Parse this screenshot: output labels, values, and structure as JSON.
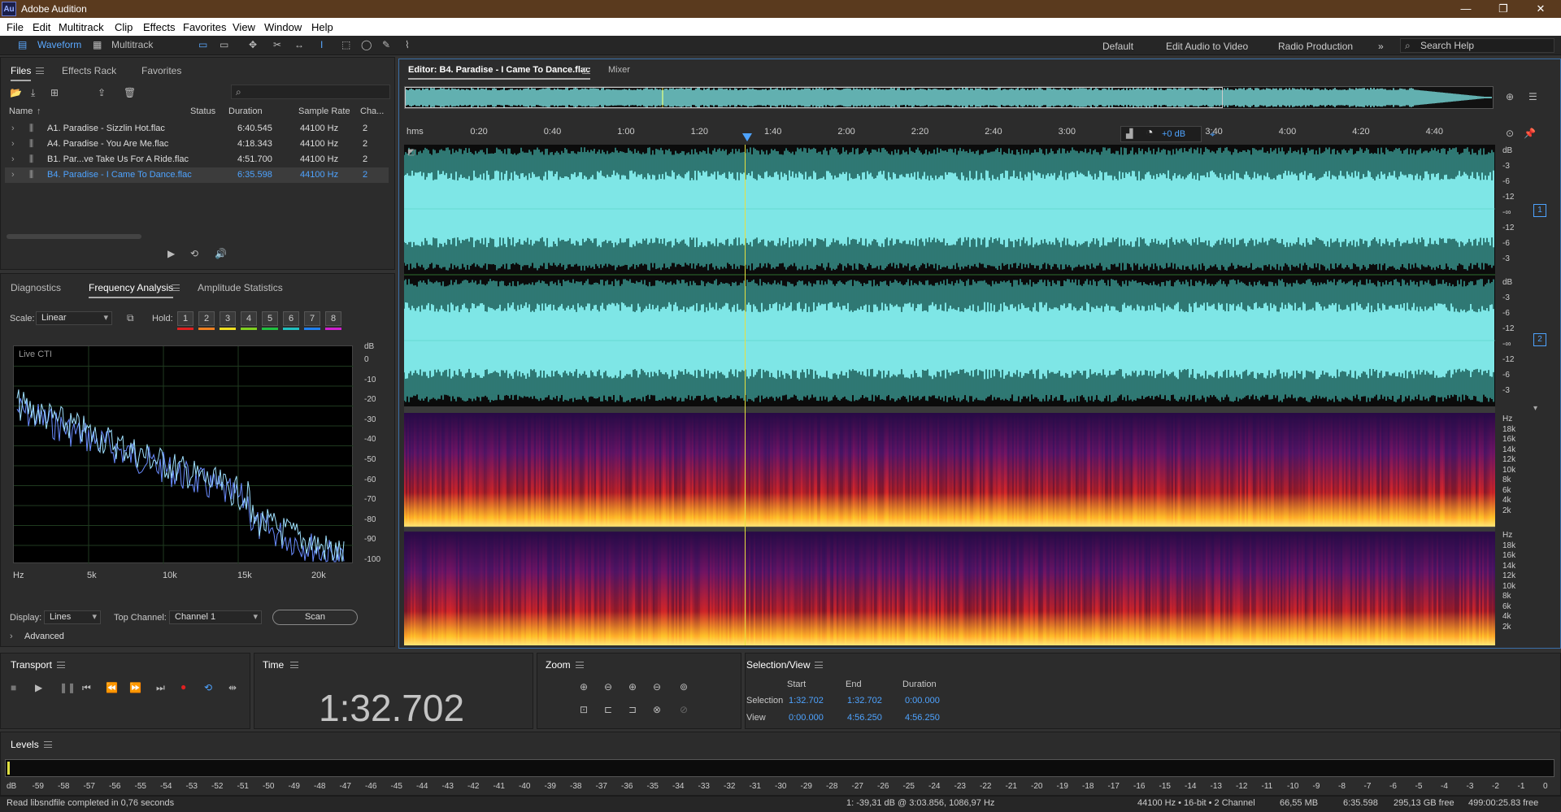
{
  "app": {
    "title": "Adobe Audition",
    "logo": "Au"
  },
  "menu": [
    "File",
    "Edit",
    "Multitrack",
    "Clip",
    "Effects",
    "Favorites",
    "View",
    "Window",
    "Help"
  ],
  "toolbar": {
    "waveform": "Waveform",
    "multitrack": "Multitrack",
    "workspaces": [
      "Default",
      "Edit Audio to Video",
      "Radio Production"
    ],
    "search_placeholder": "Search Help"
  },
  "files_panel": {
    "tabs": [
      "Files",
      "Effects Rack",
      "Favorites"
    ],
    "columns": [
      "Name",
      "Status",
      "Duration",
      "Sample Rate",
      "Cha..."
    ],
    "rows": [
      {
        "name": "A1. Paradise - Sizzlin Hot.flac",
        "duration": "6:40.545",
        "rate": "44100 Hz",
        "ch": "2"
      },
      {
        "name": "A4. Paradise - You Are Me.flac",
        "duration": "4:18.343",
        "rate": "44100 Hz",
        "ch": "2"
      },
      {
        "name": "B1. Par...ve Take Us For A Ride.flac",
        "duration": "4:51.700",
        "rate": "44100 Hz",
        "ch": "2"
      },
      {
        "name": "B4. Paradise - I Came To Dance.flac",
        "duration": "6:35.598",
        "rate": "44100 Hz",
        "ch": "2"
      }
    ]
  },
  "analysis": {
    "tabs": [
      "Diagnostics",
      "Frequency Analysis",
      "Amplitude Statistics"
    ],
    "scale_label": "Scale:",
    "scale_value": "Linear",
    "hold_label": "Hold:",
    "hold": [
      "1",
      "2",
      "3",
      "4",
      "5",
      "6",
      "7",
      "8"
    ],
    "hold_colors": [
      "#e02020",
      "#f08020",
      "#f0e020",
      "#80d020",
      "#20c040",
      "#20c0c0",
      "#2080f0",
      "#d020d0"
    ],
    "live_label": "Live CTI",
    "db_unit": "dB",
    "db_ticks": [
      "0",
      "-10",
      "-20",
      "-30",
      "-40",
      "-50",
      "-60",
      "-70",
      "-80",
      "-90",
      "-100"
    ],
    "hz_ticks": [
      "Hz",
      "5k",
      "10k",
      "15k",
      "20k"
    ],
    "display_label": "Display:",
    "display_value": "Lines",
    "top_channel_label": "Top Channel:",
    "top_channel_value": "Channel 1",
    "scan_label": "Scan",
    "advanced_label": "Advanced"
  },
  "editor": {
    "tab": "Editor: B4. Paradise - I Came To Dance.flac",
    "mixer": "Mixer",
    "ruler": [
      "hms",
      "0:20",
      "0:40",
      "1:00",
      "1:20",
      "1:40",
      "2:00",
      "2:20",
      "2:40",
      "3:00",
      "3:20",
      "3:40",
      "4:00",
      "4:20",
      "4:40"
    ],
    "hud_gain": "+0 dB",
    "db_scale": [
      "dB",
      "-3",
      "-6",
      "-12",
      "-∞",
      "-12",
      "-6",
      "-3"
    ],
    "hz_scale": [
      "Hz",
      "18k",
      "16k",
      "14k",
      "12k",
      "10k",
      "8k",
      "6k",
      "4k",
      "2k"
    ],
    "channel_badges": [
      "1",
      "2"
    ]
  },
  "transport": {
    "title": "Transport"
  },
  "time": {
    "title": "Time",
    "value": "1:32.702"
  },
  "zoom": {
    "title": "Zoom"
  },
  "selection": {
    "title": "Selection/View",
    "headers": [
      "Start",
      "End",
      "Duration"
    ],
    "rows": [
      {
        "label": "Selection",
        "start": "1:32.702",
        "end": "1:32.702",
        "duration": "0:00.000"
      },
      {
        "label": "View",
        "start": "0:00.000",
        "end": "4:56.250",
        "duration": "4:56.250"
      }
    ]
  },
  "levels": {
    "title": "Levels",
    "ticks": [
      "dB",
      "-59",
      "-58",
      "-57",
      "-56",
      "-55",
      "-54",
      "-53",
      "-52",
      "-51",
      "-50",
      "-49",
      "-48",
      "-47",
      "-46",
      "-45",
      "-44",
      "-43",
      "-42",
      "-41",
      "-40",
      "-39",
      "-38",
      "-37",
      "-36",
      "-35",
      "-34",
      "-33",
      "-32",
      "-31",
      "-30",
      "-29",
      "-28",
      "-27",
      "-26",
      "-25",
      "-24",
      "-23",
      "-22",
      "-21",
      "-20",
      "-19",
      "-18",
      "-17",
      "-16",
      "-15",
      "-14",
      "-13",
      "-12",
      "-11",
      "-10",
      "-9",
      "-8",
      "-7",
      "-6",
      "-5",
      "-4",
      "-3",
      "-2",
      "-1",
      "0"
    ]
  },
  "status": {
    "message": "Read libsndfile completed in 0,76 seconds",
    "cursor": "1: -39,31 dB @ 3:03.856, 1086,97 Hz",
    "format": "44100 Hz • 16-bit • 2 Channel",
    "size": "66,55 MB",
    "duration": "6:35.598",
    "free": "295,13 GB free",
    "free_time": "499:00:25.83 free"
  }
}
